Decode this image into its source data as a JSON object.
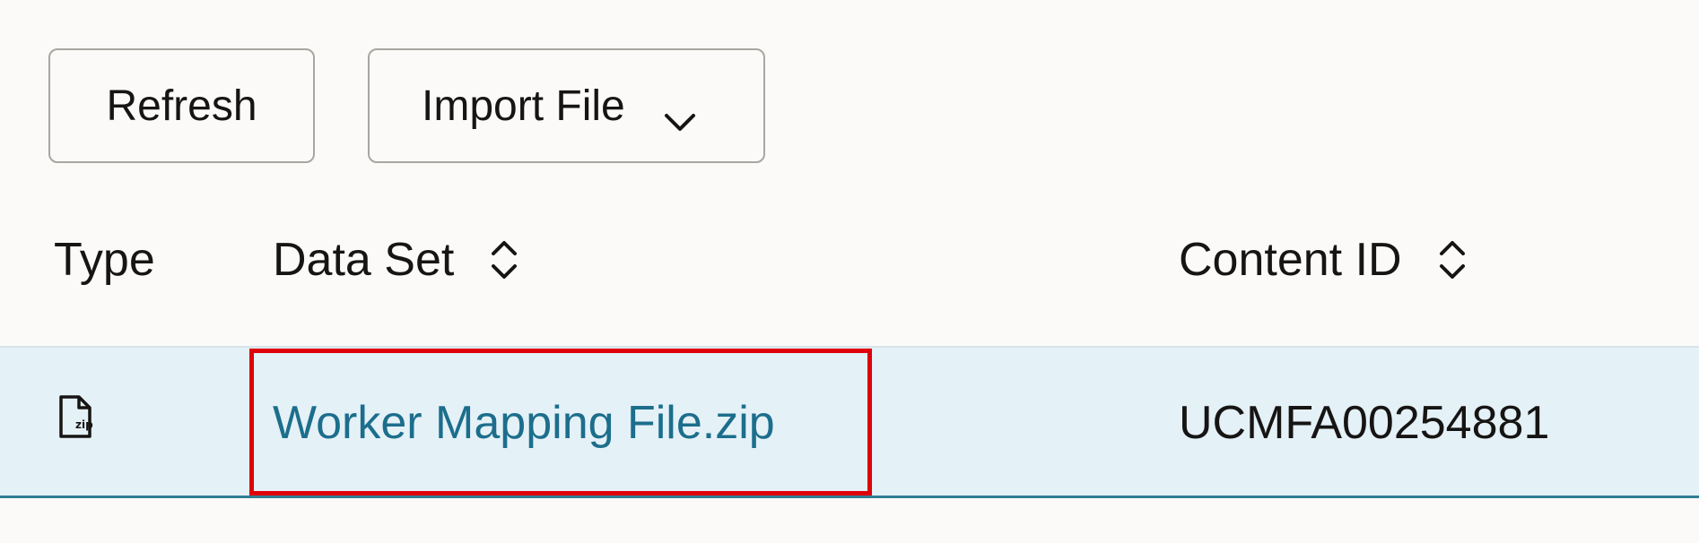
{
  "toolbar": {
    "refresh_label": "Refresh",
    "import_label": "Import File"
  },
  "table": {
    "columns": [
      "Type",
      "Data Set",
      "Content ID"
    ],
    "rows": [
      {
        "type_icon": "zip-file-icon",
        "data_set": "Worker Mapping File.zip",
        "content_id": "UCMFA00254881"
      }
    ]
  },
  "colors": {
    "background": "#fbfaf8",
    "selected_row": "#e4f1f7",
    "link": "#1c6e8c",
    "highlight": "#e0000b"
  }
}
